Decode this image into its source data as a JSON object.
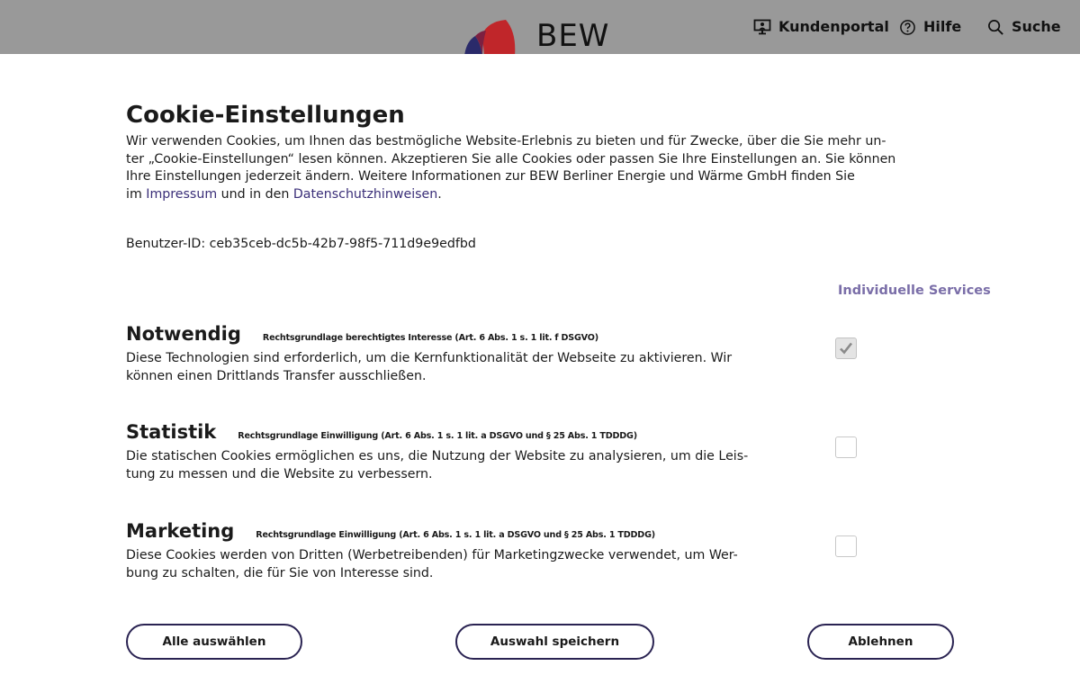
{
  "header": {
    "logo_text": "BEW",
    "nav": {
      "customer_portal": "Kundenportal",
      "help": "Hilfe",
      "search": "Suche"
    },
    "logo_colors": {
      "red": "#c0262a",
      "navy": "#2a2a6a"
    }
  },
  "modal": {
    "title": "Cookie-Einstellungen",
    "intro": {
      "line1": "Wir verwenden Cookies, um Ihnen das bestmögliche Website-Erlebnis zu bieten und für Zwecke, über die Sie mehr un-",
      "line2": "ter „Cookie-Einstellungen“ lesen können. Akzeptieren Sie alle Cookies oder passen Sie Ihre Einstellungen an. Sie können",
      "line3": "Ihre Einstellungen jederzeit ändern. Weitere Informationen zur BEW Berliner Energie und Wärme GmbH finden Sie",
      "line4_prefix": "im ",
      "imprint_link": "Impressum",
      "line4_middle": " und in den ",
      "privacy_link": "Datenschutzhinweisen",
      "line4_suffix": "."
    },
    "user_id": "Benutzer-ID: ceb35ceb-dc5b-42b7-98f5-711d9e9edfbd",
    "individual_services": "Individuelle Services",
    "sections": [
      {
        "title": "Notwendig",
        "legal": "Rechtsgrundlage berechtigtes Interesse (Art. 6 Abs. 1 s. 1 lit. f DSGVO)",
        "desc_line1": "Diese Technologien sind erforderlich, um die Kernfunktionalität der Webseite zu aktivieren. Wir",
        "desc_line2": "können einen Drittlands Transfer ausschließen.",
        "checked": true
      },
      {
        "title": "Statistik",
        "legal": "Rechtsgrundlage Einwilligung (Art. 6 Abs. 1 s. 1 lit. a DSGVO und § 25 Abs. 1 TDDDG)",
        "desc_line1": "Die statischen Cookies ermöglichen es uns, die Nutzung der Website zu analysieren, um die Leis-",
        "desc_line2": "tung zu messen und die Website zu verbessern.",
        "checked": false
      },
      {
        "title": "Marketing",
        "legal": "Rechtsgrundlage Einwilligung (Art. 6 Abs. 1 s. 1 lit. a DSGVO und § 25 Abs. 1 TDDDG)",
        "desc_line1": "Diese Cookies werden von Dritten (Werbetreibenden) für Marketingzwecke verwendet, um Wer-",
        "desc_line2": "bung zu schalten, die für Sie von Interesse sind.",
        "checked": false
      }
    ],
    "buttons": {
      "select_all": "Alle auswählen",
      "save_selection": "Auswahl speichern",
      "reject": "Ablehnen"
    }
  }
}
